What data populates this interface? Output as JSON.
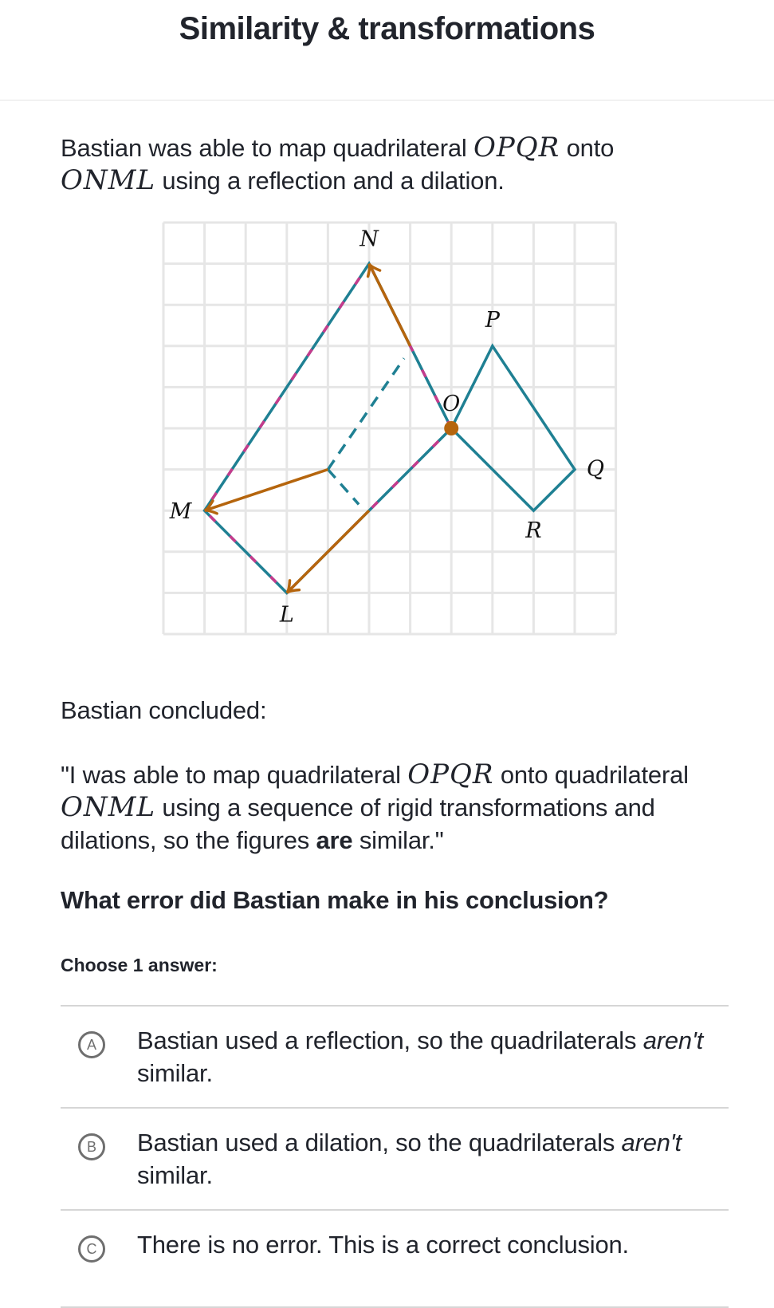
{
  "header": {
    "title": "Similarity & transformations"
  },
  "intro": {
    "before": "Bastian was able to map quadrilateral ",
    "fig1": "OPQR",
    "middle": " onto ",
    "fig2": "ONML",
    "after": " using a reflection and a dilation."
  },
  "graph": {
    "grid": {
      "cols": 11,
      "rows": 10
    },
    "colors": {
      "grid": "#e6e6e6",
      "shape": "#1f8093",
      "overlay": "#c53b8c",
      "arrow": "#b5650d",
      "center": "#b5650d"
    },
    "points": {
      "N": [
        5,
        1
      ],
      "O": [
        7,
        5
      ],
      "P": [
        8,
        3
      ],
      "Q": [
        10,
        6
      ],
      "R": [
        9,
        7
      ],
      "M": [
        1,
        7
      ],
      "L": [
        3,
        9
      ]
    },
    "labels": [
      "N",
      "O",
      "P",
      "Q",
      "R",
      "M",
      "L"
    ],
    "dilation_center": "O"
  },
  "conclusion": {
    "intro": "Bastian concluded:",
    "q_before": "\"I was able to map quadrilateral ",
    "fig1": "OPQR",
    "q_middle": " onto quadrilateral ",
    "fig2": "ONML",
    "q_after1": " using a sequence of rigid transformations and dilations, so the figures ",
    "q_bold": "are",
    "q_after2": " similar.\""
  },
  "question": "What error did Bastian make in his conclusion?",
  "choose_label": "Choose 1 answer:",
  "choices": [
    {
      "letter": "A",
      "before": "Bastian used a reflection, so the quadrilaterals ",
      "em": "aren't",
      "after": " similar."
    },
    {
      "letter": "B",
      "before": "Bastian used a dilation, so the quadrilaterals ",
      "em": "aren't",
      "after": " similar."
    },
    {
      "letter": "C",
      "before": "There is no error. This is a correct conclusion.",
      "em": "",
      "after": ""
    }
  ]
}
